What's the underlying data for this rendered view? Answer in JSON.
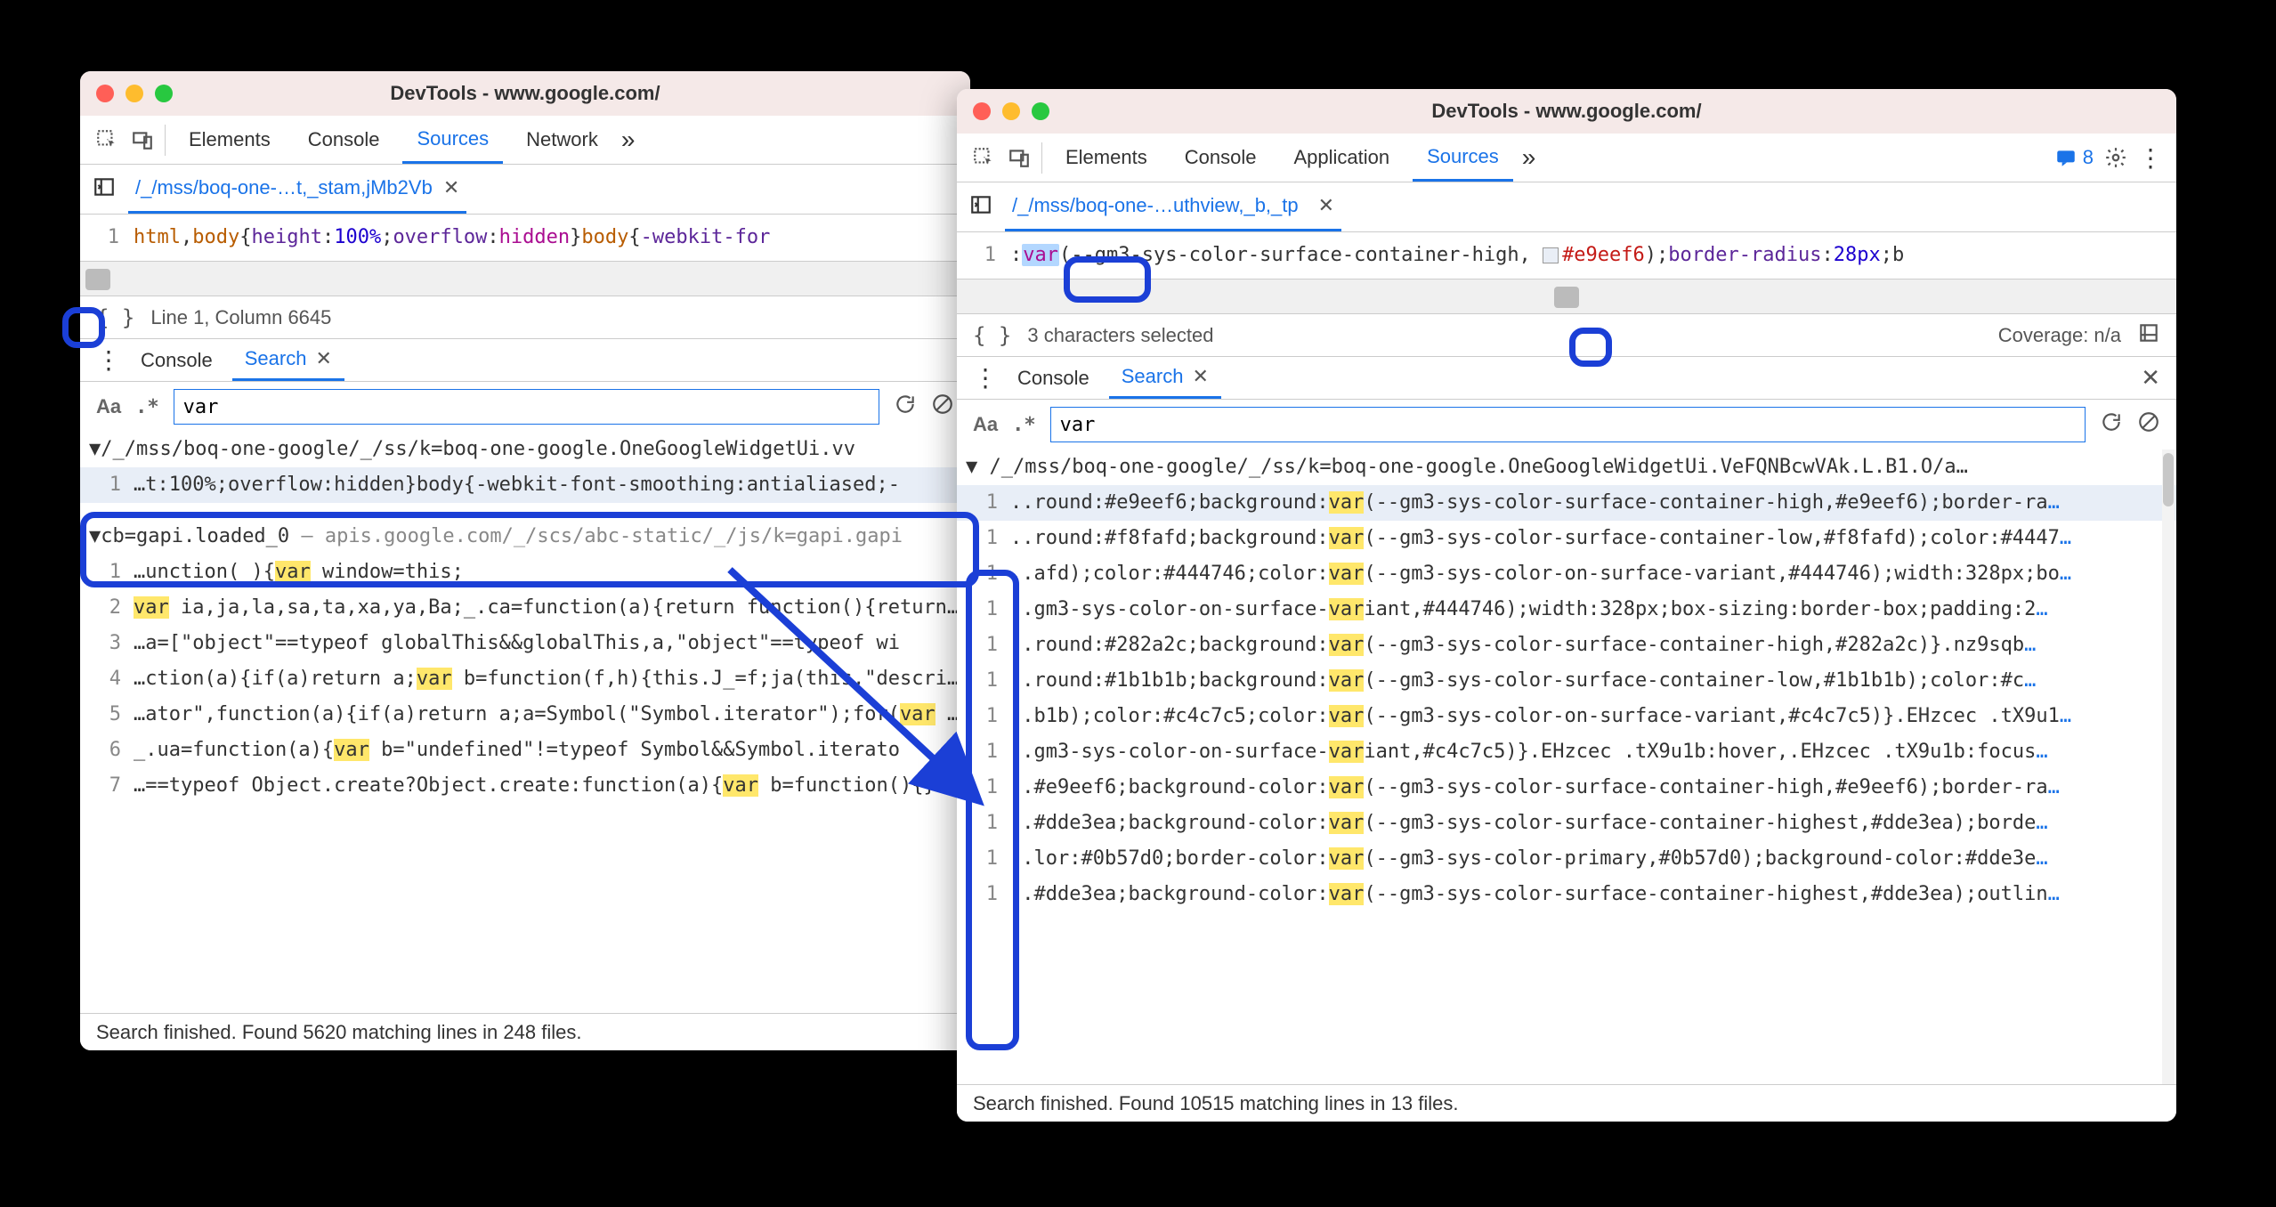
{
  "left": {
    "title": "DevTools - www.google.com/",
    "tabs": [
      "Elements",
      "Console",
      "Sources",
      "Network"
    ],
    "active_tab": "Sources",
    "file_tab": "/_/mss/boq-one-…t,_stam,jMb2Vb",
    "code": {
      "line_no": "1",
      "parts": {
        "sel1": "html",
        "comma": ",",
        "sel2": "body",
        "brace_open": "{",
        "prop1": "height",
        "colon": ":",
        "val1": "100%",
        "semi": ";",
        "prop2": "overflow",
        "val2": "hidden",
        "brace_close": "}",
        "sel3": "body",
        "brace_open2": "{",
        "prop3": "-webkit-for"
      }
    },
    "status": "Line 1, Column 6645",
    "drawer_tabs": [
      "Console",
      "Search"
    ],
    "active_drawer": "Search",
    "search": {
      "Aa": "Aa",
      "regex": ".*",
      "value": "var"
    },
    "results": {
      "group1": {
        "path": "/_/mss/boq-one-google/_/ss/k=boq-one-google.OneGoogleWidgetUi.vv",
        "rows": [
          {
            "n": "1",
            "pre": "…t:100%;overflow:hidden}body{-webkit-font-smoothing:antialiased;-"
          }
        ]
      },
      "group2": {
        "name": "cb=gapi.loaded_0",
        "origin": "apis.google.com/_/scs/abc-static/_/js/k=gapi.gapi",
        "rows": [
          {
            "n": "1",
            "pre": "…unction(_){",
            "hl": "var",
            "post": " window=this;"
          },
          {
            "n": "2",
            "pre": "",
            "hl": "var",
            "post": " ia,ja,la,sa,ta,xa,ya,Ba;_.ca=function(a){return function(){return _.ba"
          },
          {
            "n": "3",
            "pre": "…a=[\"object\"==typeof globalThis&&globalThis,a,\"object\"==typeof wi",
            "hl": "",
            "post": ""
          },
          {
            "n": "4",
            "pre": "…ction(a){if(a)return a;",
            "hl": "var",
            "post": " b=function(f,h){this.J_=f;ja(this,\"description\""
          },
          {
            "n": "5",
            "pre": "…ator\",function(a){if(a)return a;a=Symbol(\"Symbol.iterator\");for(",
            "hl": "var",
            "post": " b="
          },
          {
            "n": "6",
            "pre": "_.ua=function(a){",
            "hl": "var",
            "post": " b=\"undefined\"!=typeof Symbol&&Symbol.iterato"
          },
          {
            "n": "7",
            "pre": "…==typeof Object.create?Object.create:function(a){",
            "hl": "var",
            "post": " b=function(){}"
          }
        ]
      }
    },
    "footer": "Search finished.  Found 5620 matching lines in 248 files."
  },
  "right": {
    "title": "DevTools - www.google.com/",
    "tabs": [
      "Elements",
      "Console",
      "Application",
      "Sources"
    ],
    "active_tab": "Sources",
    "messages_count": "8",
    "file_tab": "/_/mss/boq-one-…uthview,_b,_tp",
    "code": {
      "line_no": "1",
      "lead": ":",
      "var_kw": "var",
      "args": "(--gm3-sys-color-surface-container-high,",
      "hex": "#e9eef6",
      "close": ");",
      "prop": "border-radius",
      "val": "28px",
      "tail": ";b"
    },
    "status_left": "3 characters selected",
    "status_right": "Coverage: n/a",
    "drawer_tabs": [
      "Console",
      "Search"
    ],
    "active_drawer": "Search",
    "search": {
      "Aa": "Aa",
      "regex": ".*",
      "value": "var"
    },
    "results": {
      "group_path": "/_/mss/boq-one-google/_/ss/k=boq-one-google.OneGoogleWidgetUi.VeFQNBcwVAk.L.B1.O/a…",
      "rows": [
        {
          "n": "1",
          "pre": "..round:#e9eef6;background:",
          "hl": "var",
          "post": "(--gm3-sys-color-surface-container-high,#e9eef6);border-ra",
          "ell": "…"
        },
        {
          "n": "1",
          "pre": "..round:#f8fafd;background:",
          "hl": "var",
          "post": "(--gm3-sys-color-surface-container-low,#f8fafd);color:#4447",
          "ell": "…"
        },
        {
          "n": "1",
          "pre": "..afd);color:#444746;color:",
          "hl": "var",
          "post": "(--gm3-sys-color-on-surface-variant,#444746);width:328px;bo",
          "ell": "…"
        },
        {
          "n": "1",
          "pre": "..gm3-sys-color-on-surface-",
          "hl": "var",
          "post": "iant,#444746);width:328px;box-sizing:border-box;padding:2",
          "ell": "…"
        },
        {
          "n": "1",
          "pre": "..round:#282a2c;background:",
          "hl": "var",
          "post": "(--gm3-sys-color-surface-container-high,#282a2c)}.nz9sqb",
          "ell": "…"
        },
        {
          "n": "1",
          "pre": "..round:#1b1b1b;background:",
          "hl": "var",
          "post": "(--gm3-sys-color-surface-container-low,#1b1b1b);color:#c",
          "ell": "…"
        },
        {
          "n": "1",
          "pre": "..b1b);color:#c4c7c5;color:",
          "hl": "var",
          "post": "(--gm3-sys-color-on-surface-variant,#c4c7c5)}.EHzcec .tX9u1",
          "ell": "…"
        },
        {
          "n": "1",
          "pre": "..gm3-sys-color-on-surface-",
          "hl": "var",
          "post": "iant,#c4c7c5)}.EHzcec .tX9u1b:hover,.EHzcec .tX9u1b:focus",
          "ell": "…"
        },
        {
          "n": "1",
          "pre": "..#e9eef6;background-color:",
          "hl": "var",
          "post": "(--gm3-sys-color-surface-container-high,#e9eef6);border-ra",
          "ell": "…"
        },
        {
          "n": "1",
          "pre": "..#dde3ea;background-color:",
          "hl": "var",
          "post": "(--gm3-sys-color-surface-container-highest,#dde3ea);borde",
          "ell": "…"
        },
        {
          "n": "1",
          "pre": "..lor:#0b57d0;border-color:",
          "hl": "var",
          "post": "(--gm3-sys-color-primary,#0b57d0);background-color:#dde3e",
          "ell": "…"
        },
        {
          "n": "1",
          "pre": "..#dde3ea;background-color:",
          "hl": "var",
          "post": "(--gm3-sys-color-surface-container-highest,#dde3ea);outlin",
          "ell": "…"
        }
      ]
    },
    "footer": "Search finished.  Found 10515 matching lines in 13 files."
  }
}
